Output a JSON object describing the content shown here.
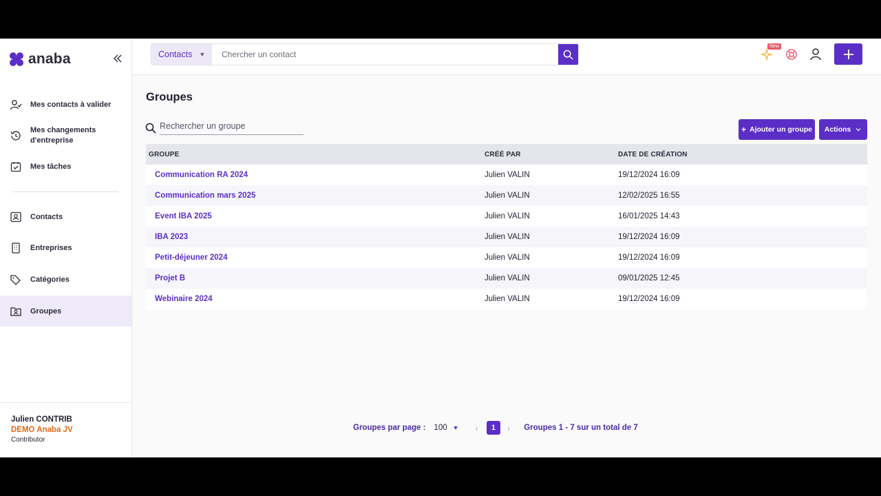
{
  "brand": {
    "name": "anaba"
  },
  "sidebar": {
    "items": [
      {
        "label": "Mes contacts à valider",
        "icon": "user-check-icon"
      },
      {
        "label": "Mes changements d'entreprise",
        "icon": "history-icon"
      },
      {
        "label": "Mes tâches",
        "icon": "calendar-check-icon"
      },
      {
        "label": "Contacts",
        "icon": "contact-card-icon"
      },
      {
        "label": "Entreprises",
        "icon": "building-icon"
      },
      {
        "label": "Catégories",
        "icon": "tags-icon"
      },
      {
        "label": "Groupes",
        "icon": "group-folder-icon",
        "active": true
      }
    ],
    "user": {
      "name": "Julien CONTRIB",
      "org": "DEMO Anaba JV",
      "role": "Contributor"
    }
  },
  "topbar": {
    "search_type": "Contacts",
    "search_placeholder": "Chercher un contact",
    "new_badge": "New"
  },
  "main": {
    "title": "Groupes",
    "search_placeholder": "Rechercher un groupe",
    "add_button": "Ajouter un groupe",
    "actions_button": "Actions",
    "columns": [
      "GROUPE",
      "CRÉÉ PAR",
      "DATE DE CRÉATION"
    ],
    "rows": [
      {
        "name": "Communication RA 2024",
        "created_by": "Julien VALIN",
        "date": "19/12/2024 16:09"
      },
      {
        "name": "Communication mars 2025",
        "created_by": "Julien VALIN",
        "date": "12/02/2025 16:55"
      },
      {
        "name": "Event IBA 2025",
        "created_by": "Julien VALIN",
        "date": "16/01/2025 14:43"
      },
      {
        "name": "IBA 2023",
        "created_by": "Julien VALIN",
        "date": "19/12/2024 16:09"
      },
      {
        "name": "Petit-déjeuner 2024",
        "created_by": "Julien VALIN",
        "date": "19/12/2024 16:09"
      },
      {
        "name": "Projet B",
        "created_by": "Julien VALIN",
        "date": "09/01/2025 12:45"
      },
      {
        "name": "Webinaire 2024",
        "created_by": "Julien VALIN",
        "date": "19/12/2024 16:09"
      }
    ]
  },
  "pagination": {
    "per_page_label": "Groupes par page :",
    "per_page_value": "100",
    "current_page": "1",
    "summary": "Groupes 1 - 7 sur un total de 7"
  },
  "colors": {
    "accent": "#5b2fc7",
    "org": "#e06a1b",
    "badge": "#e85a6d"
  }
}
